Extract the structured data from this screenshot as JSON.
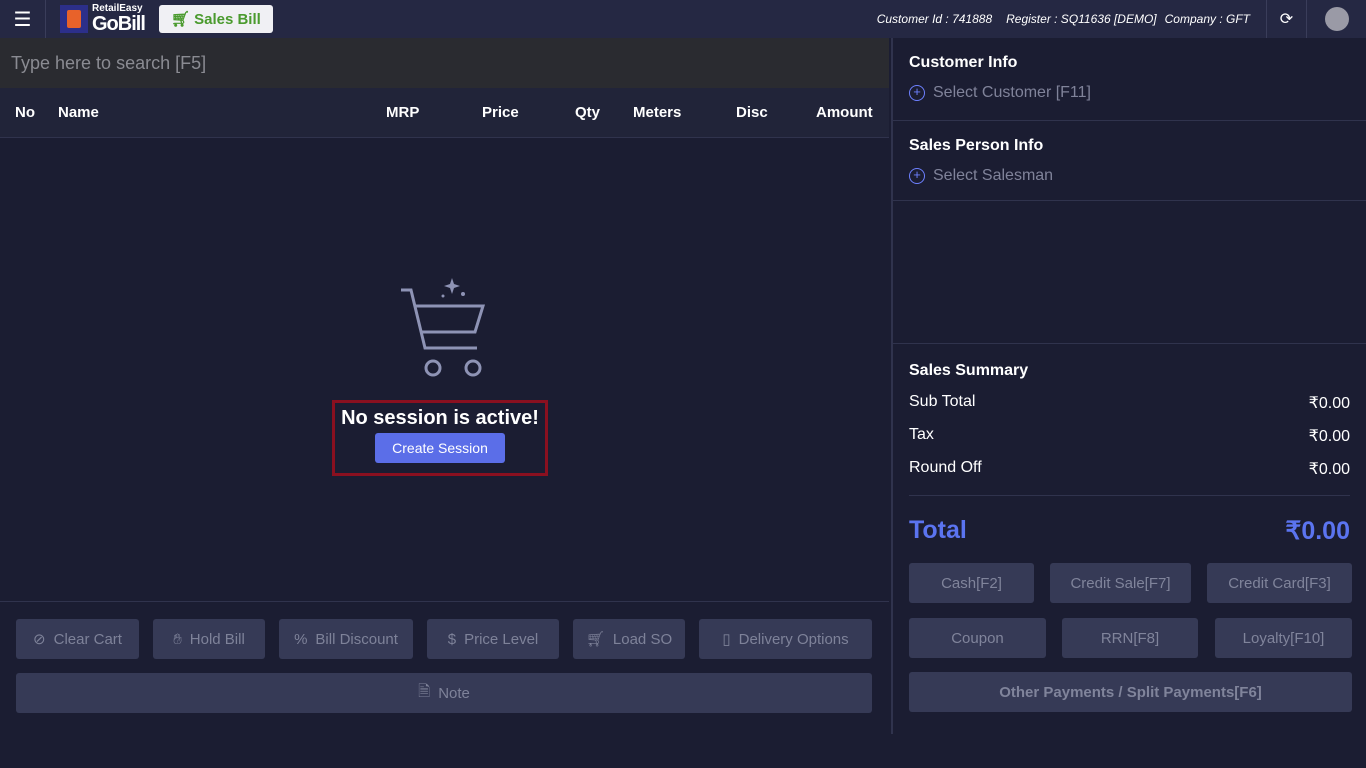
{
  "topbar": {
    "brand_small": "RetailEasy",
    "brand_big": "GoBill",
    "sales_bill": "Sales Bill",
    "customer_id": "Customer Id : 741888",
    "register": "Register : SQ11636 [DEMO]",
    "company": "Company : GFT"
  },
  "search": {
    "placeholder": "Type here to search [F5]"
  },
  "table": {
    "columns": [
      "No",
      "Name",
      "MRP",
      "Price",
      "Qty",
      "Meters",
      "Disc",
      "Amount"
    ]
  },
  "empty": {
    "message": "No session is active!",
    "create_session": "Create Session"
  },
  "actions": {
    "clear_cart": "Clear Cart",
    "hold_bill": "Hold Bill",
    "bill_discount": "Bill Discount",
    "price_level": "Price Level",
    "load_so": "Load SO",
    "delivery_options": "Delivery Options",
    "note": "Note"
  },
  "customer": {
    "title": "Customer Info",
    "select": "Select Customer [F11]"
  },
  "salesperson": {
    "title": "Sales Person Info",
    "select": "Select Salesman"
  },
  "summary": {
    "title": "Sales Summary",
    "sub_total_label": "Sub Total",
    "sub_total": "₹0.00",
    "tax_label": "Tax",
    "tax": "₹0.00",
    "round_off_label": "Round Off",
    "round_off": "₹0.00",
    "total_label": "Total",
    "total": "₹0.00"
  },
  "payments": {
    "cash": "Cash[F2]",
    "credit_sale": "Credit Sale[F7]",
    "credit_card": "Credit Card[F3]",
    "coupon": "Coupon",
    "rrn": "RRN[F8]",
    "loyalty": "Loyalty[F10]",
    "other": "Other Payments / Split Payments[F6]"
  }
}
